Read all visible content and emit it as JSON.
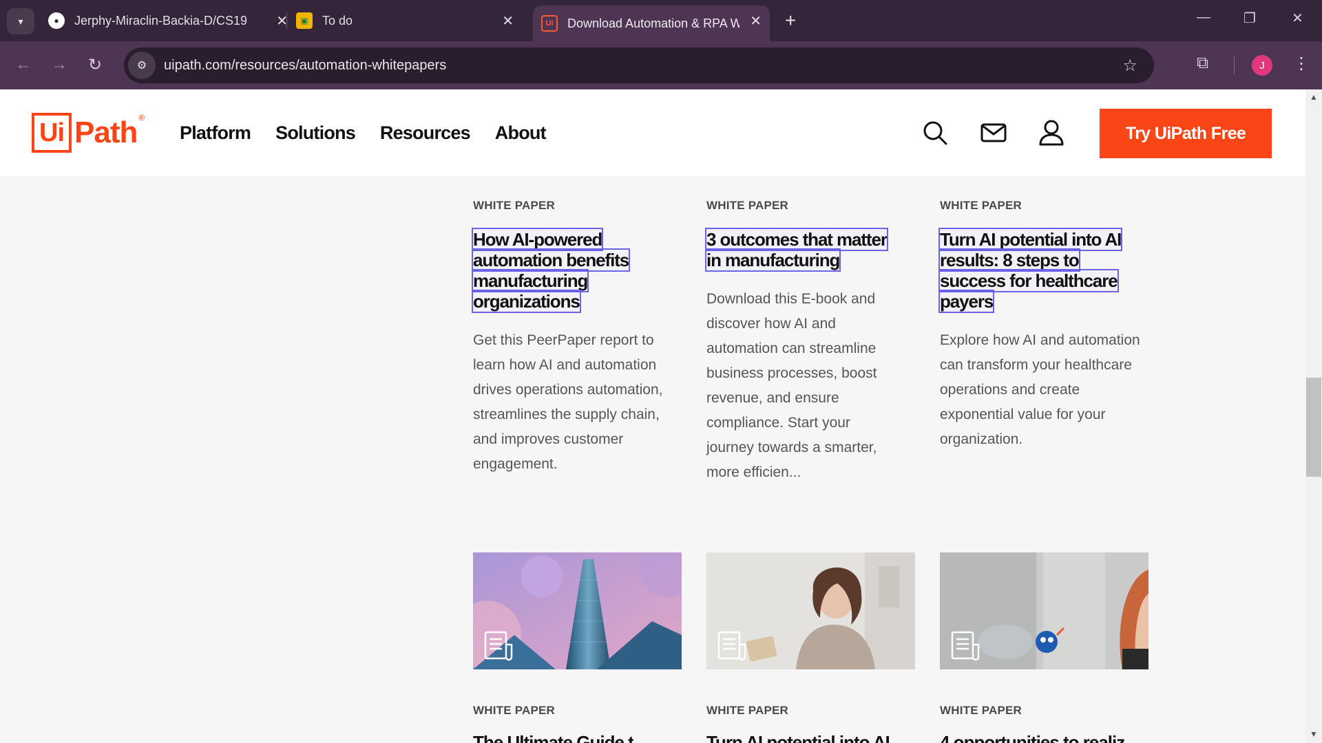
{
  "browser": {
    "tabs": [
      {
        "title": "Jerphy-Miraclin-Backia-D/CS19",
        "icon": "github-icon"
      },
      {
        "title": "To do",
        "icon": "classroom-icon"
      },
      {
        "title": "Download Automation & RPA W",
        "icon": "uipath-icon",
        "active": true
      }
    ],
    "url": "uipath.com/resources/automation-whitepapers",
    "avatar_initial": "J",
    "favicon_text": "Ui"
  },
  "header": {
    "logo_box": "Ui",
    "logo_text": "Path",
    "logo_reg": "®",
    "nav": [
      "Platform",
      "Solutions",
      "Resources",
      "About"
    ],
    "cta": "Try UiPath Free"
  },
  "cards": [
    {
      "eyebrow": "WHITE PAPER",
      "title_lines": [
        "How AI-powered",
        "automation benefits",
        "manufacturing",
        "organizations"
      ],
      "desc": "Get this PeerPaper report to learn how AI and automation drives operations automation, streamlines the supply chain, and improves customer engagement."
    },
    {
      "eyebrow": "WHITE PAPER",
      "title_lines": [
        "3 outcomes that matter",
        "in manufacturing"
      ],
      "desc": "Download this E-book and discover how AI and automation can streamline business processes, boost revenue, and ensure compliance. Start your journey towards a smarter, more efficien..."
    },
    {
      "eyebrow": "WHITE PAPER",
      "title_lines": [
        "Turn AI potential into AI",
        "results: 8 steps to",
        "success for healthcare",
        "payers"
      ],
      "desc": "Explore how AI and automation can transform your healthcare operations and create exponential value for your organization."
    }
  ],
  "next_cards": [
    {
      "eyebrow": "WHITE PAPER",
      "title_fragment": "The Ultimate Guide t"
    },
    {
      "eyebrow": "WHITE PAPER",
      "title_fragment": "Turn AI potential into AI"
    },
    {
      "eyebrow": "WHITE PAPER",
      "title_fragment": "4 opportunities to realiz"
    }
  ],
  "colors": {
    "brand": "#fa4616",
    "chrome_dark": "#35253a",
    "chrome_toolbar": "#4d3553",
    "focus_outline": "#6a63e8"
  }
}
